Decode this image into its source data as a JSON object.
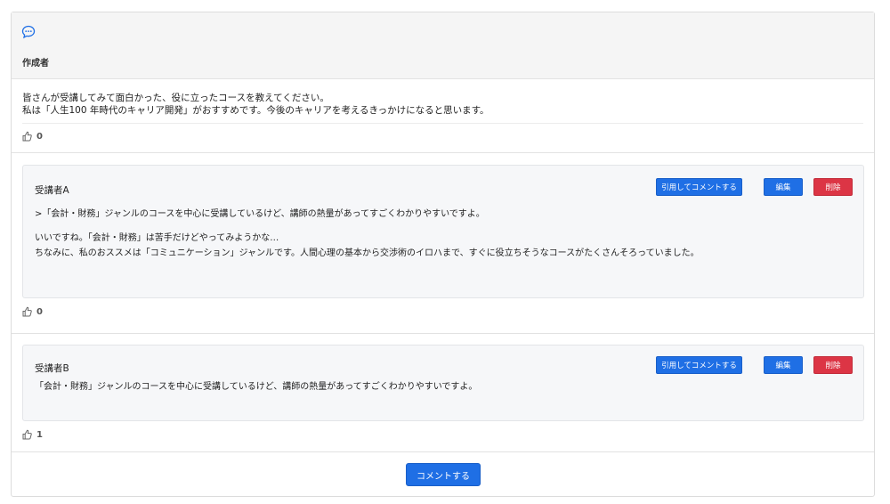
{
  "post": {
    "author_label": "作成者",
    "lines": [
      "皆さんが受講してみて面白かった、役に立ったコースを教えてください。",
      "私は「人生100 年時代のキャリア開発」がおすすめです。今後のキャリアを考えるきっかけになると思います。"
    ],
    "likes": "0"
  },
  "comments": [
    {
      "author": "受講者A",
      "lines": [
        ">「会計・財務」ジャンルのコースを中心に受講しているけど、講師の熱量があってすごくわかりやすいですよ。",
        "いいですね。「会計・財務」は苦手だけどやってみようかな…",
        "ちなみに、私のおススメは「コミュニケーション」ジャンルです。人間心理の基本から交渉術のイロハまで、すぐに役立ちそうなコースがたくさんそろっていました。"
      ],
      "likes": "0"
    },
    {
      "author": "受講者B",
      "lines": [
        "「会計・財務」ジャンルのコースを中心に受講しているけど、講師の熱量があってすごくわかりやすいですよ。"
      ],
      "likes": "1"
    }
  ],
  "buttons": {
    "quote": "引用してコメントする",
    "edit": "編集",
    "delete": "削除",
    "comment": "コメントする"
  },
  "colors": {
    "primary": "#1f6fe5",
    "danger": "#dc3545"
  },
  "icons": {
    "header": "chat-bubble-icon",
    "like": "thumbs-up-icon"
  }
}
